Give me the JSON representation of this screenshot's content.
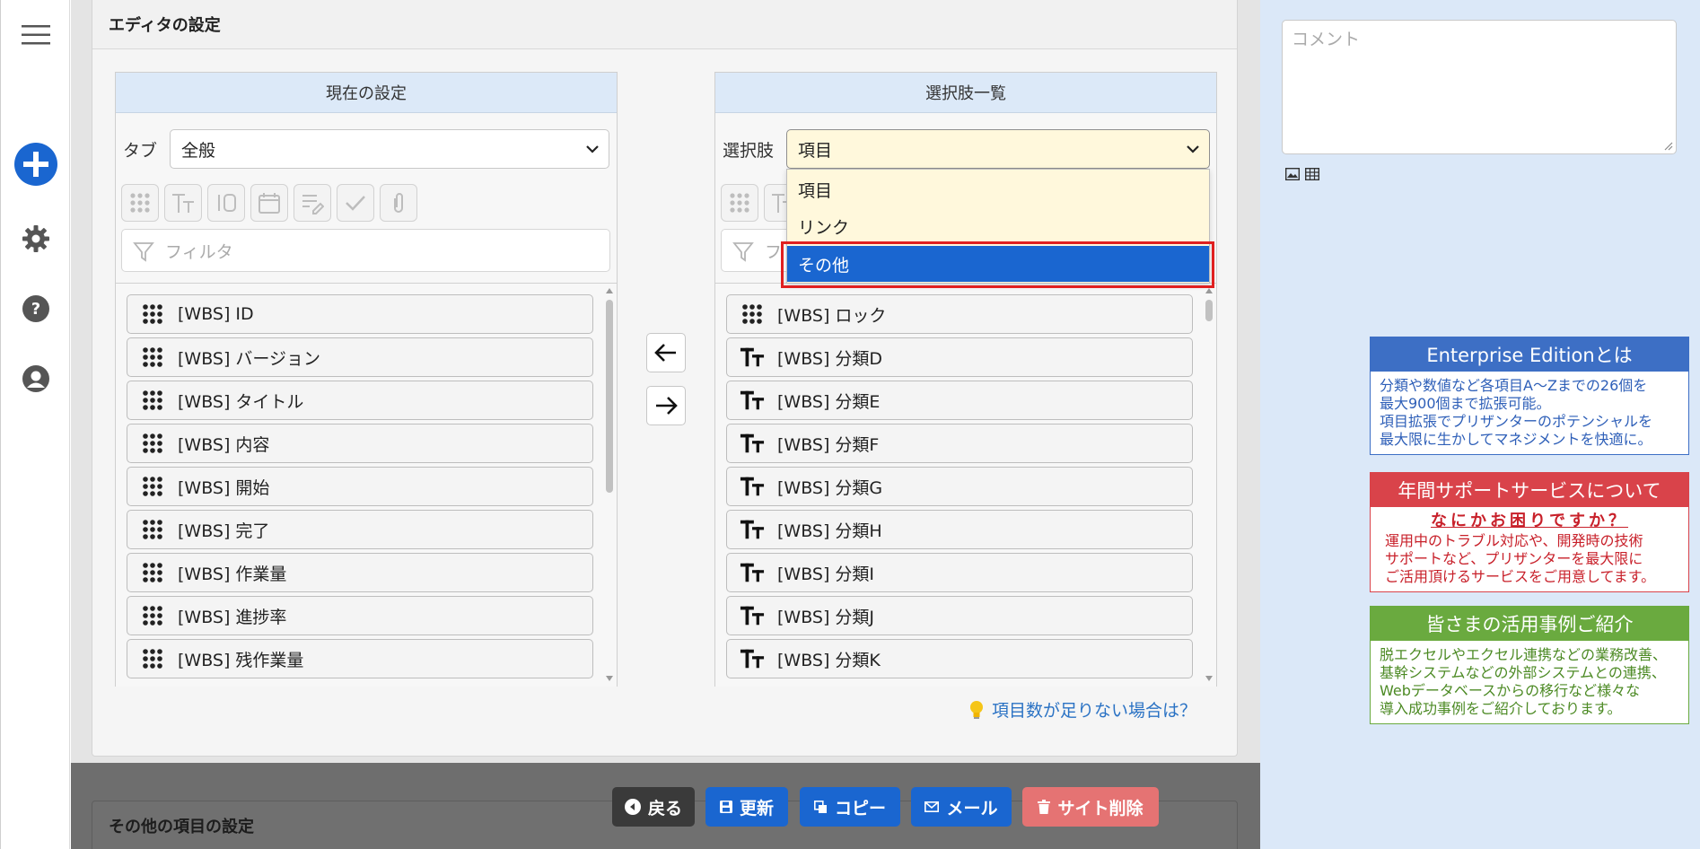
{
  "editor": {
    "title": "エディタの設定",
    "current": {
      "header": "現在の設定",
      "tab_label": "タブ",
      "tab_value": "全般",
      "filter_placeholder": "フィルタ",
      "items": [
        {
          "label": "[WBS] ID",
          "icon": "grid-icon"
        },
        {
          "label": "[WBS] バージョン",
          "icon": "grid-icon"
        },
        {
          "label": "[WBS] タイトル",
          "icon": "grid-icon"
        },
        {
          "label": "[WBS] 内容",
          "icon": "grid-icon"
        },
        {
          "label": "[WBS] 開始",
          "icon": "grid-icon"
        },
        {
          "label": "[WBS] 完了",
          "icon": "grid-icon"
        },
        {
          "label": "[WBS] 作業量",
          "icon": "grid-icon"
        },
        {
          "label": "[WBS] 進捗率",
          "icon": "grid-icon"
        },
        {
          "label": "[WBS] 残作業量",
          "icon": "grid-icon"
        }
      ]
    },
    "choices": {
      "header": "選択肢一覧",
      "select_label": "選択肢",
      "select_value": "項目",
      "dropdown_options": [
        "項目",
        "リンク",
        "その他"
      ],
      "selected_option": "その他",
      "filter_placeholder": "フ",
      "items": [
        {
          "label": "[WBS] ロック",
          "icon": "grid-icon"
        },
        {
          "label": "[WBS] 分類D",
          "icon": "text-type-icon"
        },
        {
          "label": "[WBS] 分類E",
          "icon": "text-type-icon"
        },
        {
          "label": "[WBS] 分類F",
          "icon": "text-type-icon"
        },
        {
          "label": "[WBS] 分類G",
          "icon": "text-type-icon"
        },
        {
          "label": "[WBS] 分類H",
          "icon": "text-type-icon"
        },
        {
          "label": "[WBS] 分類I",
          "icon": "text-type-icon"
        },
        {
          "label": "[WBS] 分類J",
          "icon": "text-type-icon"
        },
        {
          "label": "[WBS] 分類K",
          "icon": "text-type-icon"
        }
      ]
    },
    "hint": "項目数が足りない場合は？"
  },
  "next_section_title": "その他の項目の設定",
  "actions": {
    "back": "戻る",
    "update": "更新",
    "copy": "コピー",
    "mail": "メール",
    "delete_site": "サイト削除"
  },
  "comment_placeholder": "コメント",
  "ads": [
    {
      "title": "Enterprise Editionとは",
      "subtitle": "",
      "lines": [
        "分類や数値など各項目A～Zまでの26個を",
        "最大900個まで拡張可能。",
        "項目拡張でプリザンターのポテンシャルを",
        "最大限に生かしてマネジメントを快適に。"
      ]
    },
    {
      "title": "年間サポートサービスについて",
      "subtitle": "なにかお困りですか？",
      "lines": [
        "運用中のトラブル対応や、開発時の技術",
        "サポートなど、プリザンターを最大限に",
        "ご活用頂けるサービスをご用意してます。"
      ]
    },
    {
      "title": "皆さまの活用事例ご紹介",
      "subtitle": "",
      "lines": [
        "脱エクセルやエクセル連携などの業務改善、",
        "基幹システムなどの外部システムとの連携、",
        "Webデータベースからの移行など様々な",
        "導入成功事例をご紹介しております。"
      ]
    }
  ],
  "colors": {
    "primary": "#1a66d0",
    "back_button": "#3a3a3a",
    "delete_button": "#e57373",
    "ad_blue": "#3d6fc5",
    "ad_red": "#d9434a",
    "ad_green": "#6aaa3f",
    "selection_highlight": "#e02020"
  }
}
